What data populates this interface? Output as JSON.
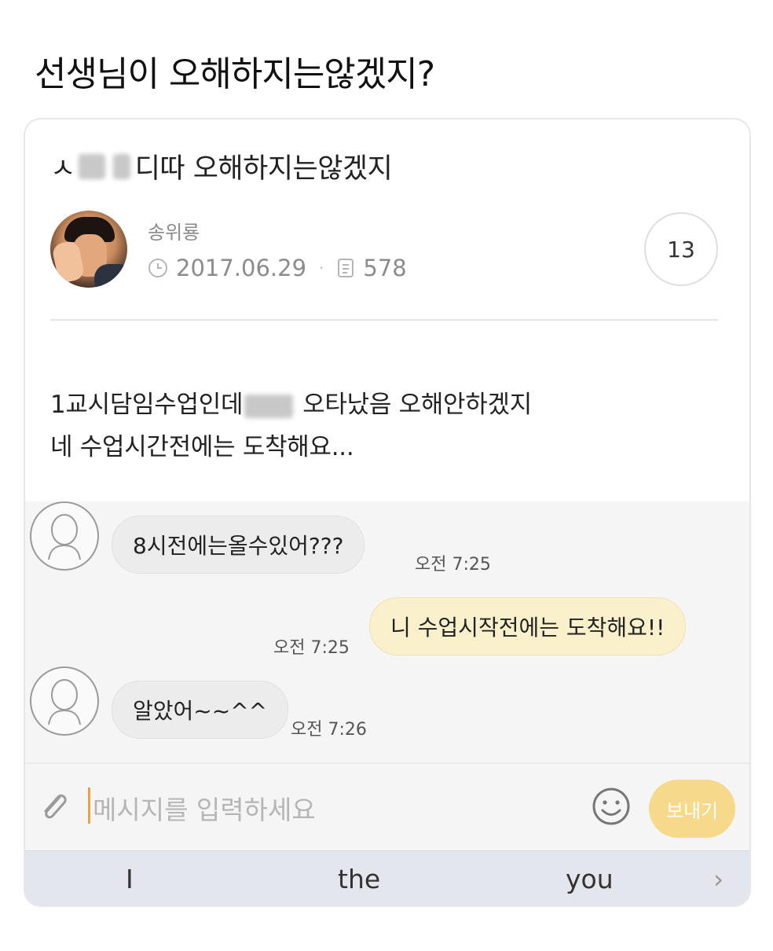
{
  "headline": "선생님이 오해하지는않겠지?",
  "post": {
    "title_prefix": "ㅅ",
    "title_suffix": "디따 오해하지는않겠지",
    "author": "송위룡",
    "date": "2017.06.29",
    "views": "578",
    "comment_count": "13",
    "body_line1_prefix": "1교시담임수업인데",
    "body_line1_suffix": "오타났음 오해안하겠지",
    "body_line2": "네 수업시간전에는 도착해요..."
  },
  "chat": {
    "messages": [
      {
        "direction": "in",
        "text": "8시전에는올수있어???",
        "time": "오전 7:25"
      },
      {
        "direction": "out",
        "text": "니 수업시작전에는 도착해요!!",
        "time": "오전 7:25"
      },
      {
        "direction": "in",
        "text": "알았어~~^^",
        "time": "오전 7:26"
      }
    ]
  },
  "input": {
    "placeholder": "메시지를 입력하세요",
    "send_label": "보내기"
  },
  "keyboard": {
    "suggestions": [
      "I",
      "the",
      "you"
    ],
    "arrow": "›"
  },
  "colors": {
    "incoming_bubble": "#ececec",
    "outgoing_bubble": "#fbf0cc",
    "send_button": "#f7d98c",
    "caret": "#e8a33b"
  }
}
